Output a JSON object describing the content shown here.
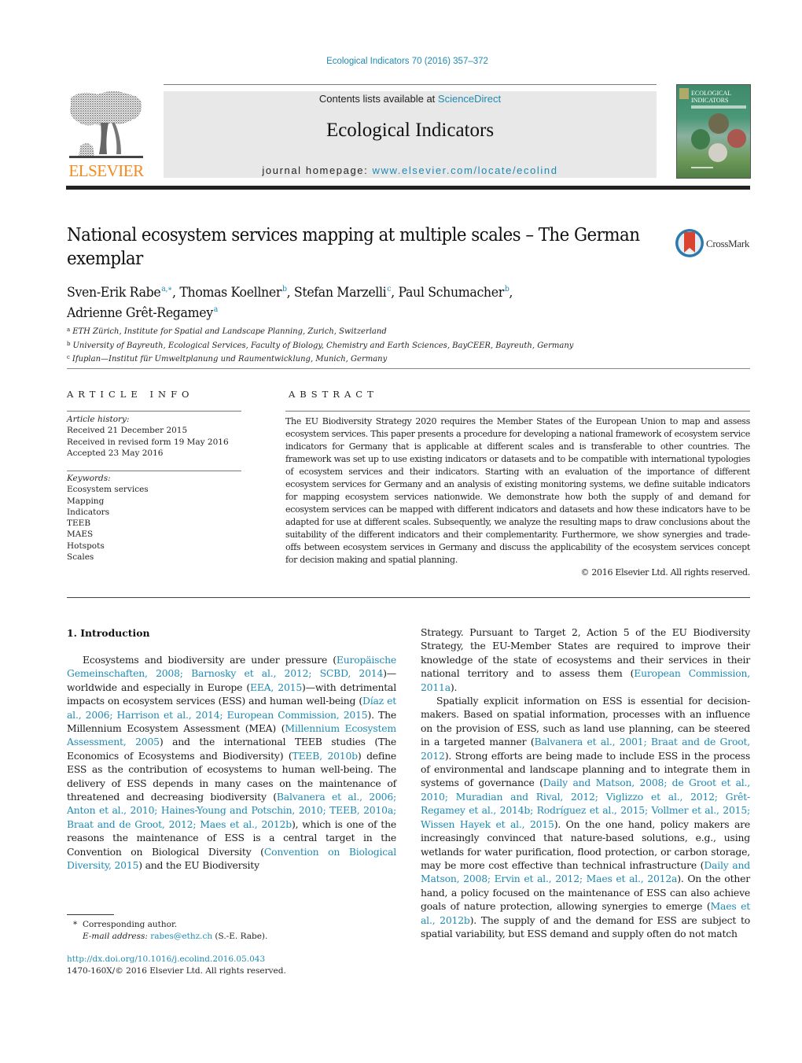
{
  "header": {
    "journal_reference": "Ecological Indicators 70 (2016) 357–372",
    "contents_prefix": "Contents lists available at ",
    "contents_link": "ScienceDirect",
    "journal_title": "Ecological Indicators",
    "homepage_prefix": "journal homepage: ",
    "homepage_link": "www.elsevier.com/locate/ecolind",
    "publisher_wordmark": "ELSEVIER",
    "cover_title_line1": "ECOLOGICAL",
    "cover_title_line2": "INDICATORS"
  },
  "article": {
    "title": "National ecosystem services mapping at multiple scales – The German exemplar",
    "crossmark_label": "CrossMark",
    "authors": [
      {
        "name": "Sven-Erik Rabe",
        "aff": "a,∗",
        "sep": ", "
      },
      {
        "name": "Thomas Koellner",
        "aff": "b",
        "sep": ", "
      },
      {
        "name": "Stefan Marzelli",
        "aff": "c",
        "sep": ", "
      },
      {
        "name": "Paul Schumacher",
        "aff": "b",
        "sep": ","
      },
      {
        "name": "Adrienne Grêt-Regamey",
        "aff": "a",
        "sep": ""
      }
    ],
    "affiliations": [
      {
        "key": "a",
        "text": "ETH Zürich, Institute for Spatial and Landscape Planning, Zurich, Switzerland"
      },
      {
        "key": "b",
        "text": "University of Bayreuth, Ecological Services, Faculty of Biology, Chemistry and Earth Sciences, BayCEER, Bayreuth, Germany"
      },
      {
        "key": "c",
        "text": "Ifuplan—Institut für Umweltplanung und Raumentwicklung, Munich, Germany"
      }
    ]
  },
  "article_info": {
    "heading": "ARTICLE INFO",
    "history_label": "Article history:",
    "history": [
      "Received 21 December 2015",
      "Received in revised form 19 May 2016",
      "Accepted 23 May 2016"
    ],
    "keywords_label": "Keywords:",
    "keywords": [
      "Ecosystem services",
      "Mapping",
      "Indicators",
      "TEEB",
      "MAES",
      "Hotspots",
      "Scales"
    ]
  },
  "abstract": {
    "heading": "ABSTRACT",
    "text": "The EU Biodiversity Strategy 2020 requires the Member States of the European Union to map and assess ecosystem services. This paper presents a procedure for developing a national framework of ecosystem service indicators for Germany that is applicable at different scales and is transferable to other countries. The framework was set up to use existing indicators or datasets and to be compatible with international typologies of ecosystem services and their indicators. Starting with an evaluation of the importance of different ecosystem services for Germany and an analysis of existing monitoring systems, we define suitable indicators for mapping ecosystem services nationwide. We demonstrate how both the supply of and demand for ecosystem services can be mapped with different indicators and datasets and how these indicators have to be adapted for use at different scales. Subsequently, we analyze the resulting maps to draw conclusions about the suitability of the different indicators and their complementarity. Furthermore, we show synergies and trade-offs between ecosystem services in Germany and discuss the applicability of the ecosystem services concept for decision making and spatial planning.",
    "copyright": "© 2016 Elsevier Ltd. All rights reserved."
  },
  "body": {
    "section_heading": "1.  Introduction",
    "left_paragraphs": [
      [
        {
          "t": "Ecosystems and biodiversity are under pressure ("
        },
        {
          "l": "Europäische Gemeinschaften, 2008; Barnosky et al., 2012; SCBD, 2014"
        },
        {
          "t": ")—worldwide and especially in Europe ("
        },
        {
          "l": "EEA, 2015"
        },
        {
          "t": ")—with detrimental impacts on ecosystem services (ESS) and human well-being ("
        },
        {
          "l": "Díaz et al., 2006; Harrison et al., 2014; European Commission, 2015"
        },
        {
          "t": "). The Millennium Ecosystem Assessment (MEA) ("
        },
        {
          "l": "Millennium Ecosystem Assessment, 2005"
        },
        {
          "t": ") and the international TEEB studies (The Economics of Ecosystems and Biodiversity) ("
        },
        {
          "l": "TEEB, 2010b"
        },
        {
          "t": ") define ESS as the contribution of ecosystems to human well-being. The delivery of ESS depends in many cases on the maintenance of threatened and decreasing biodiversity ("
        },
        {
          "l": "Balvanera et al., 2006; Anton et al., 2010; Haines-Young and Potschin, 2010; TEEB, 2010a; Braat and de Groot, 2012; Maes et al., 2012b"
        },
        {
          "t": "), which is one of the reasons the maintenance of ESS is a central target in the Convention on Biological Diversity ("
        },
        {
          "l": "Convention on Biological Diversity, 2015"
        },
        {
          "t": ") and the EU Biodiversity"
        }
      ]
    ],
    "right_paragraphs": [
      [
        {
          "t": "Strategy. Pursuant to Target 2, Action 5 of the EU Biodiversity Strategy, the EU-Member States are required to improve their knowledge of the state of ecosystems and their services in their national territory and to assess them ("
        },
        {
          "l": "European Commission, 2011a"
        },
        {
          "t": ")."
        }
      ],
      [
        {
          "t": "Spatially explicit information on ESS is essential for decision-makers. Based on spatial information, processes with an influence on the provision of ESS, such as land use planning, can be steered in a targeted manner ("
        },
        {
          "l": "Balvanera et al., 2001; Braat and de Groot, 2012"
        },
        {
          "t": "). Strong efforts are being made to include ESS in the process of environmental and landscape planning and to integrate them in systems of governance ("
        },
        {
          "l": "Daily and Matson, 2008; de Groot et al., 2010; Muradian and Rival, 2012; Viglizzo et al., 2012; Grêt-Regamey et al., 2014b; Rodríguez et al., 2015; Vollmer et al., 2015; Wissen Hayek et al., 2015"
        },
        {
          "t": "). On the one hand, policy makers are increasingly convinced that nature-based solutions, e.g., using wetlands for water purification, flood protection, or carbon storage, may be more cost effective than technical infrastructure ("
        },
        {
          "l": "Daily and Matson, 2008; Ervin et al., 2012; Maes et al., 2012a"
        },
        {
          "t": "). On the other hand, a policy focused on the maintenance of ESS can also achieve goals of nature protection, allowing synergies to emerge ("
        },
        {
          "l": "Maes et al., 2012b"
        },
        {
          "t": "). The supply of and the demand for ESS are subject to spatial variability, but ESS demand and supply often do not match"
        }
      ]
    ]
  },
  "footnotes": {
    "marker": "*",
    "corresponding": "Corresponding author.",
    "email_label": "E-mail address:",
    "email": "rabes@ethz.ch",
    "email_suffix": " (S.-E. Rabe).",
    "doi_link": "http://dx.doi.org/10.1016/j.ecolind.2016.05.043",
    "issn_line": "1470-160X/© 2016 Elsevier Ltd. All rights reserved."
  },
  "colors": {
    "link": "#1f8ab3",
    "elsevier_orange": "#f28a22",
    "masthead_gray": "#e8e8e8",
    "crossmark_red": "#d9432f",
    "crossmark_blue": "#2a7ab0"
  }
}
